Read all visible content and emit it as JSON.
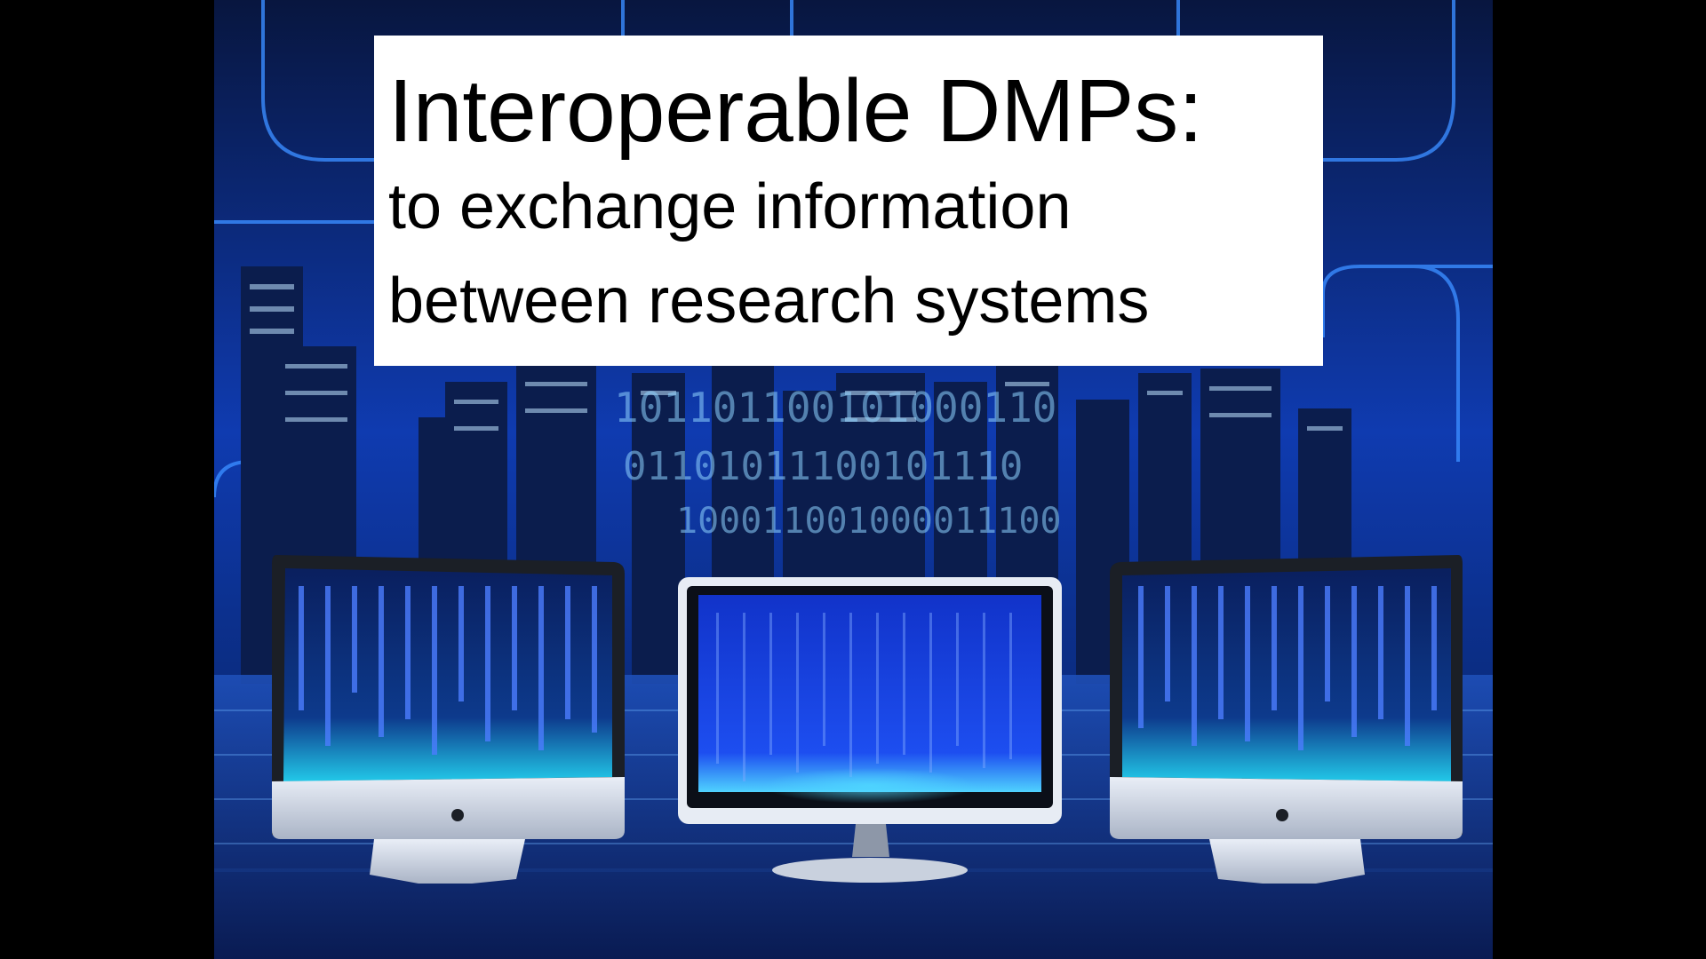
{
  "slide": {
    "title": "Interoperable DMPs:",
    "subtitle_line1": "to exchange information",
    "subtitle_line2": "between research systems"
  },
  "scene": {
    "background_icon": "city-skyline-icon",
    "monitor_icons": [
      "monitor-left-icon",
      "monitor-center-icon",
      "monitor-right-icon"
    ],
    "binary_rows": [
      "101101100101000110",
      "01101011100101110",
      "100011001000011100"
    ]
  },
  "colors": {
    "letterbox": "#000000",
    "accent_blue": "#1a5bd6",
    "glow_cyan": "#3fd8ff",
    "title_bg": "#ffffff",
    "title_text": "#000000"
  }
}
